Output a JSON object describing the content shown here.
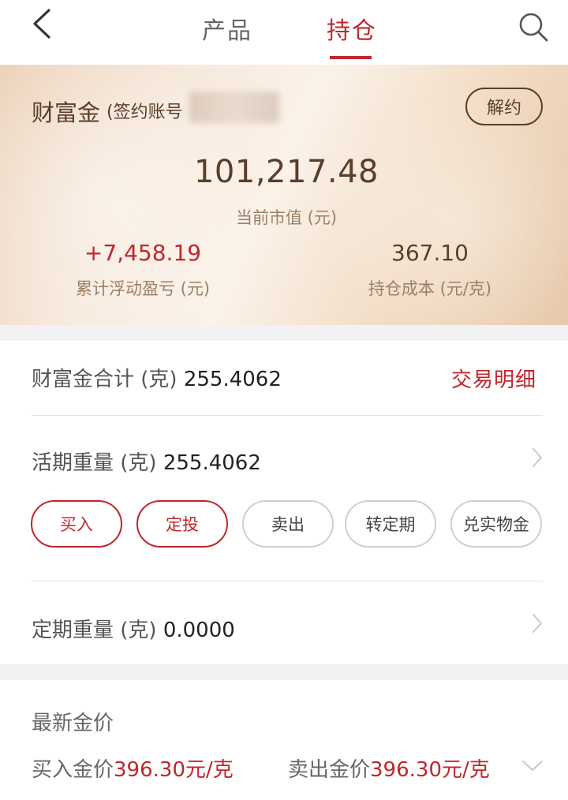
{
  "nav": {
    "tabs": [
      "产品",
      "持仓"
    ],
    "active_tab": "持仓",
    "back_icon": "chevron-left-icon",
    "search_icon": "search-icon"
  },
  "card": {
    "title": "财富金",
    "account_label": "(签约账号",
    "unbind_label": "解约",
    "market_value": "101,217.48",
    "market_value_label": "当前市值 (元)",
    "pnl_value": "+7,458.19",
    "pnl_label": "累计浮动盈亏 (元)",
    "cost_value": "367.10",
    "cost_label": "持仓成本 (元/克)"
  },
  "holdings": {
    "total_label": "财富金合计 (克)",
    "total_value": "255.4062",
    "detail_link": "交易明细",
    "current_label": "活期重量 (克)",
    "current_value": "255.4062",
    "actions": [
      "买入",
      "定投",
      "卖出",
      "转定期",
      "兑实物金"
    ],
    "fixed_label": "定期重量 (克)",
    "fixed_value": "0.0000"
  },
  "prices": {
    "title": "最新金价",
    "buy_label": "买入金价",
    "buy_value": "396.30元/克",
    "sell_label": "卖出金价",
    "sell_value": "396.30元/克"
  },
  "colors": {
    "accent_red": "#c0262c",
    "card_text_brown": "#5a3e2a"
  }
}
